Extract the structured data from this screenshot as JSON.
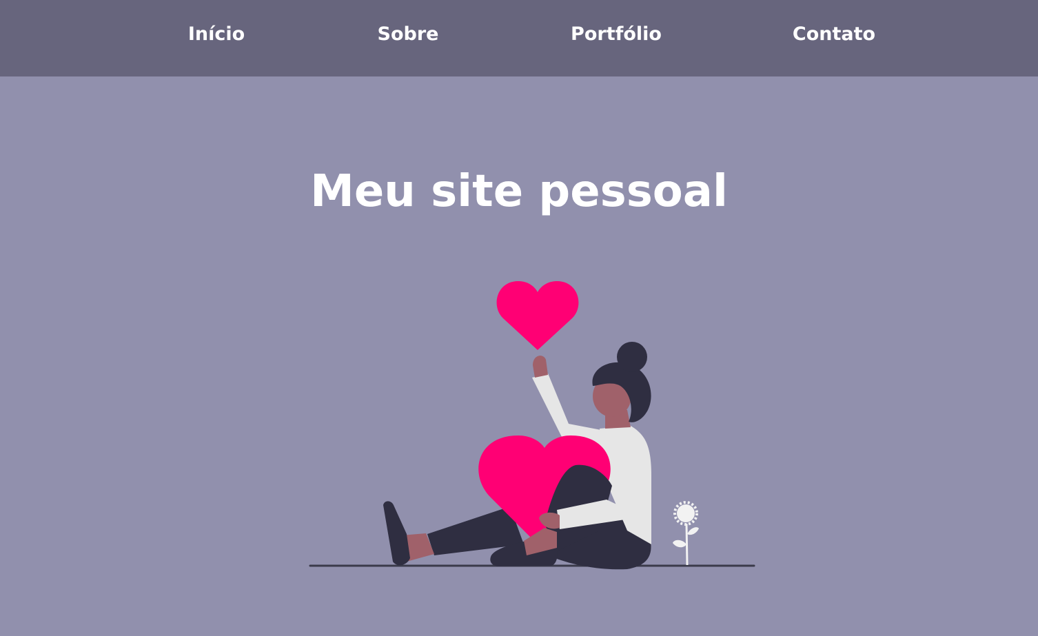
{
  "nav": {
    "items": [
      {
        "label": "Início"
      },
      {
        "label": "Sobre"
      },
      {
        "label": "Portfólio"
      },
      {
        "label": "Contato"
      }
    ]
  },
  "hero": {
    "title": "Meu site pessoal"
  },
  "colors": {
    "background": "#9190ad",
    "navbar": "#67657d",
    "accent_heart": "#ff0074",
    "text": "#ffffff"
  }
}
